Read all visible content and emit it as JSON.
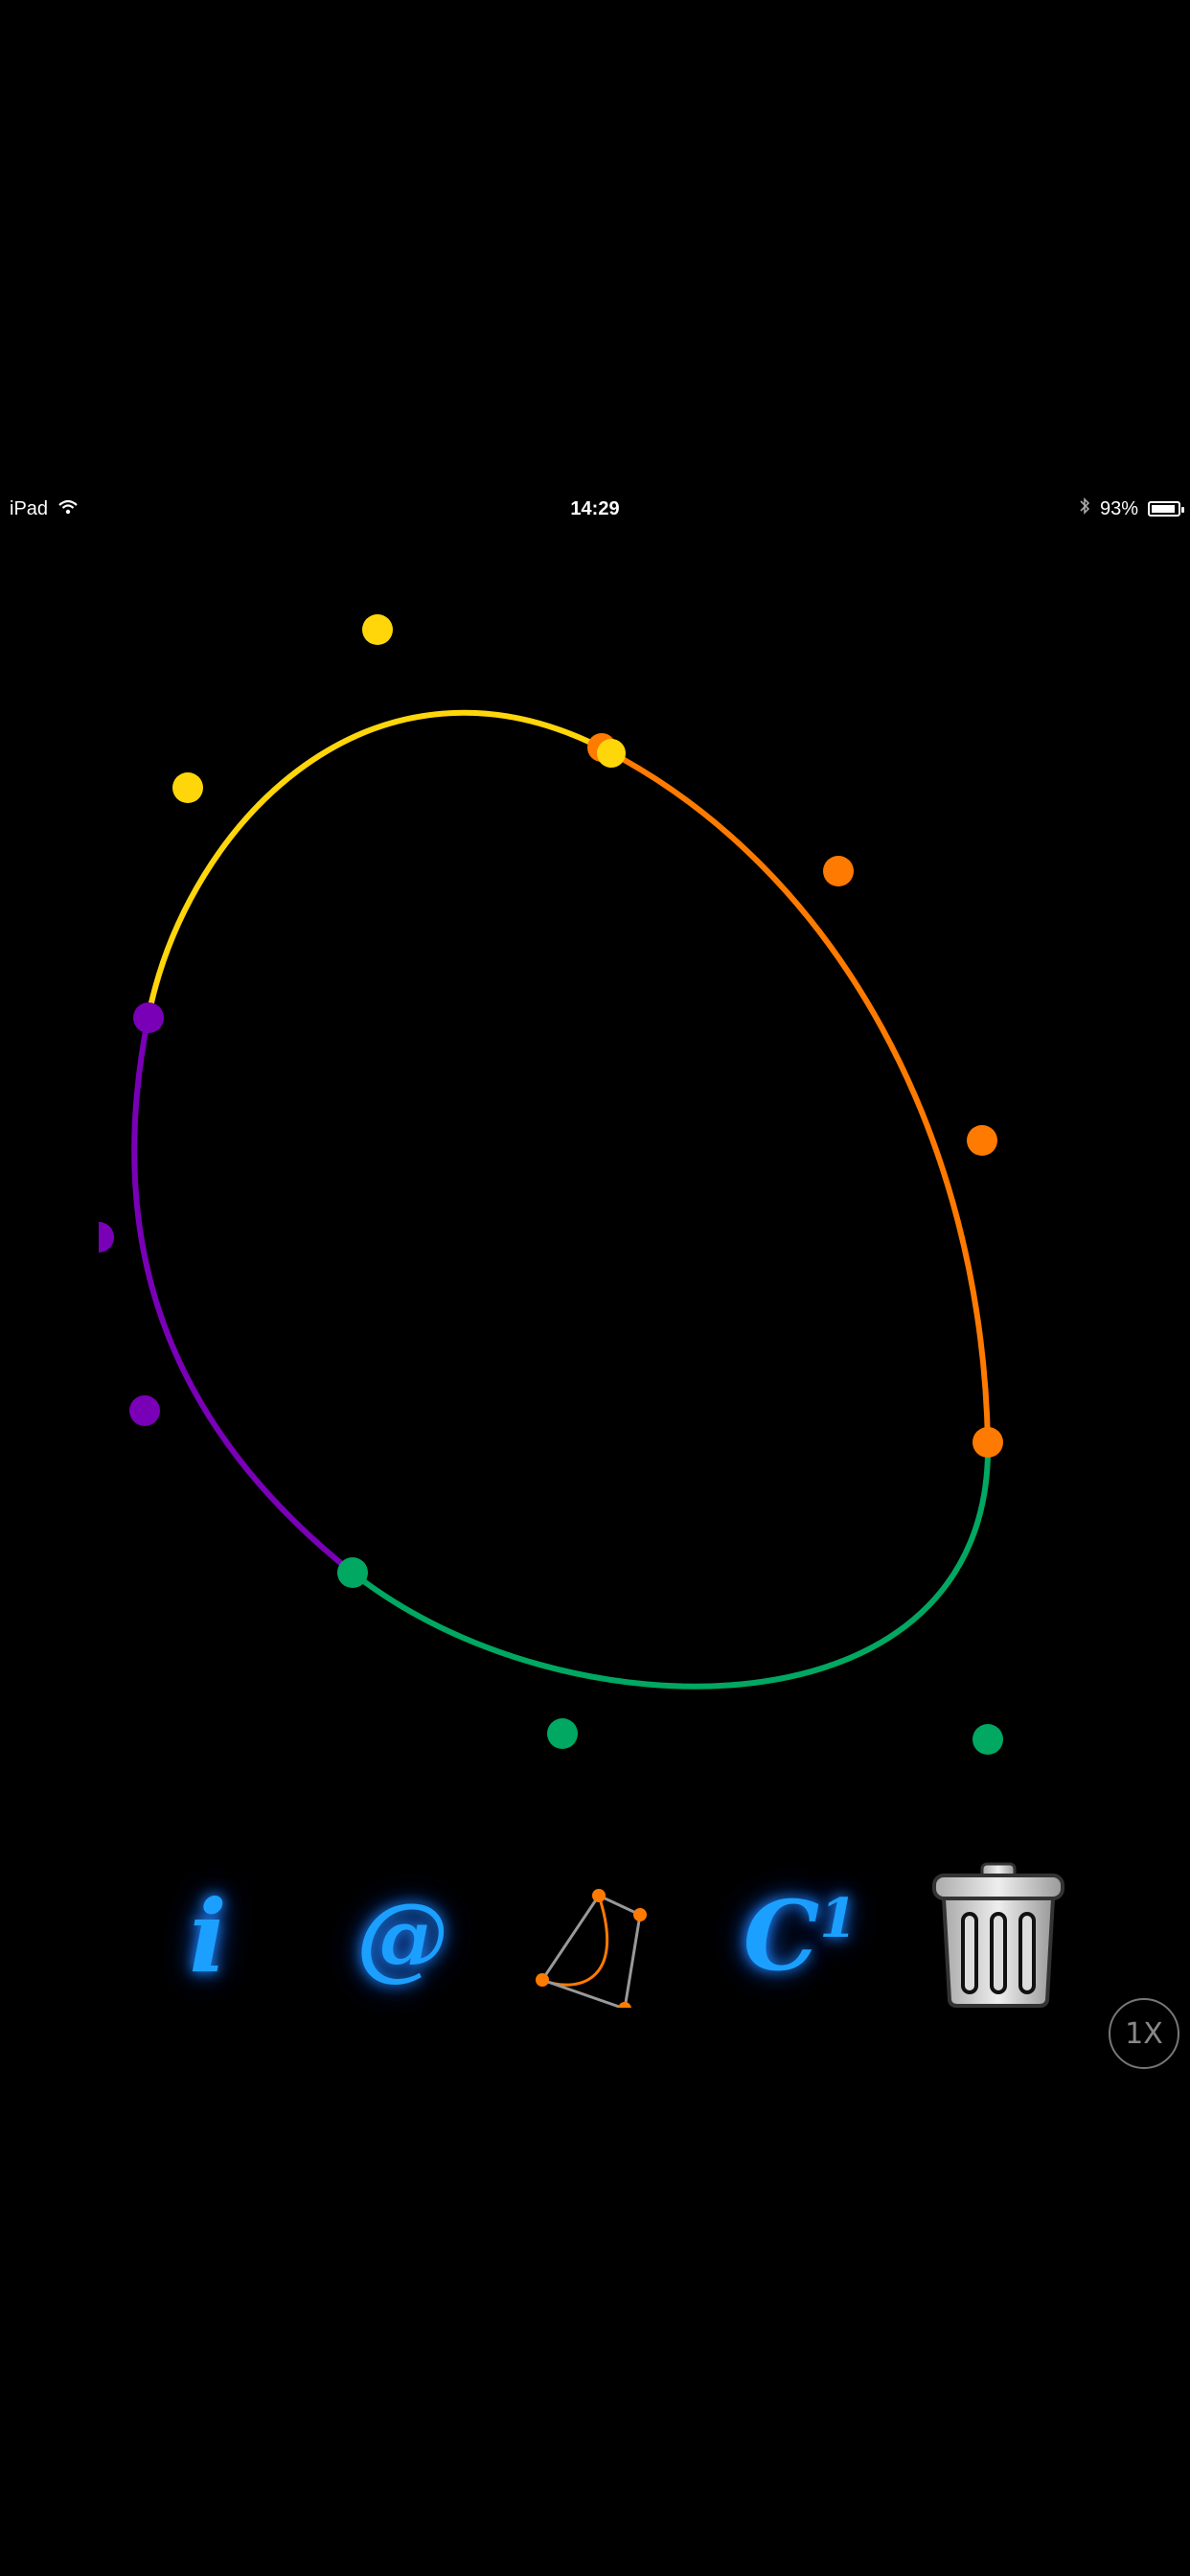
{
  "status_bar": {
    "device": "iPad",
    "time": "14:29",
    "battery": "93%",
    "battery_level": 0.93,
    "icons": [
      "wifi-icon",
      "bluetooth-icon",
      "battery-icon"
    ]
  },
  "curve": {
    "segments": [
      {
        "name": "yellow-segment",
        "color": "#FFD60A"
      },
      {
        "name": "orange-segment",
        "color": "#FF7A00"
      },
      {
        "name": "green-segment",
        "color": "#00A862"
      },
      {
        "name": "purple-segment",
        "color": "#7A00B8"
      }
    ]
  },
  "toolbar": {
    "info_label": "i",
    "contact_label": "@",
    "bezier_icon": "bezier-curve-icon",
    "continuity_label": "C",
    "continuity_sup": "1",
    "trash_icon": "trash-icon",
    "accent_color": "#1CA0FF"
  },
  "speed": {
    "label": "1X"
  }
}
